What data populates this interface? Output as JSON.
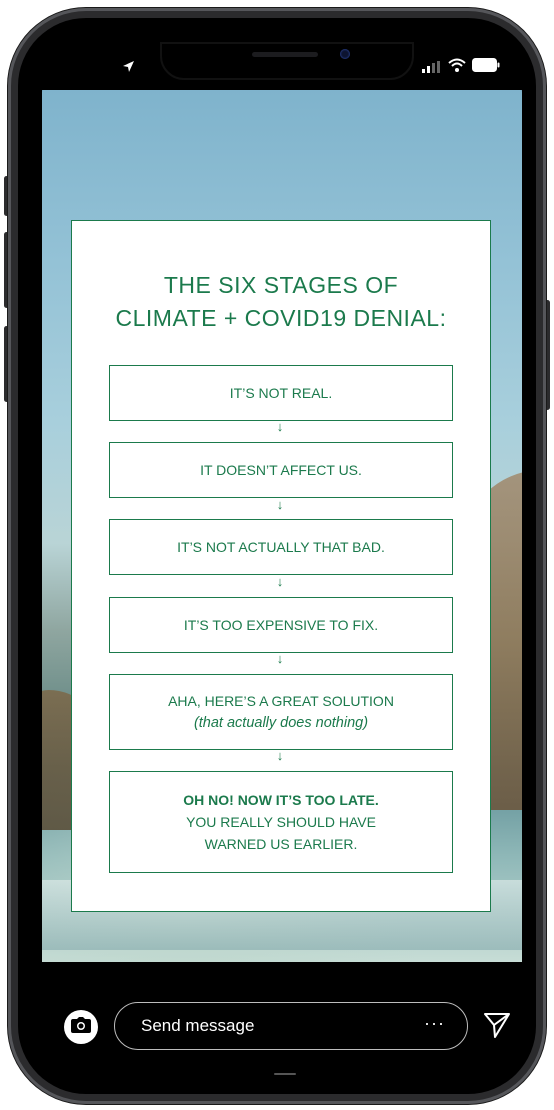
{
  "card": {
    "title_line1": "THE SIX STAGES OF",
    "title_line2": "CLIMATE + COVID19 DENIAL:",
    "stages": [
      {
        "line1": "IT’S NOT REAL."
      },
      {
        "line1": "IT DOESN’T AFFECT US."
      },
      {
        "line1": "IT’S NOT ACTUALLY THAT BAD."
      },
      {
        "line1": "IT’S TOO EXPENSIVE TO FIX."
      },
      {
        "line1": "AHA, HERE’S A GREAT SOLUTION",
        "line2": "(that actually does nothing)"
      },
      {
        "line1": "OH NO! NOW IT’S TOO LATE.",
        "line2": "YOU REALLY SHOULD HAVE",
        "line3": "WARNED US EARLIER."
      }
    ],
    "arrow": "↓"
  },
  "reply_bar": {
    "placeholder": "Send message",
    "more": "···"
  },
  "colors": {
    "accent": "#1b7a4c",
    "bar": "#000000"
  },
  "icons": [
    "location-arrow-icon",
    "signal-icon",
    "wifi-icon",
    "battery-icon",
    "camera-icon",
    "more-icon",
    "send-icon"
  ]
}
